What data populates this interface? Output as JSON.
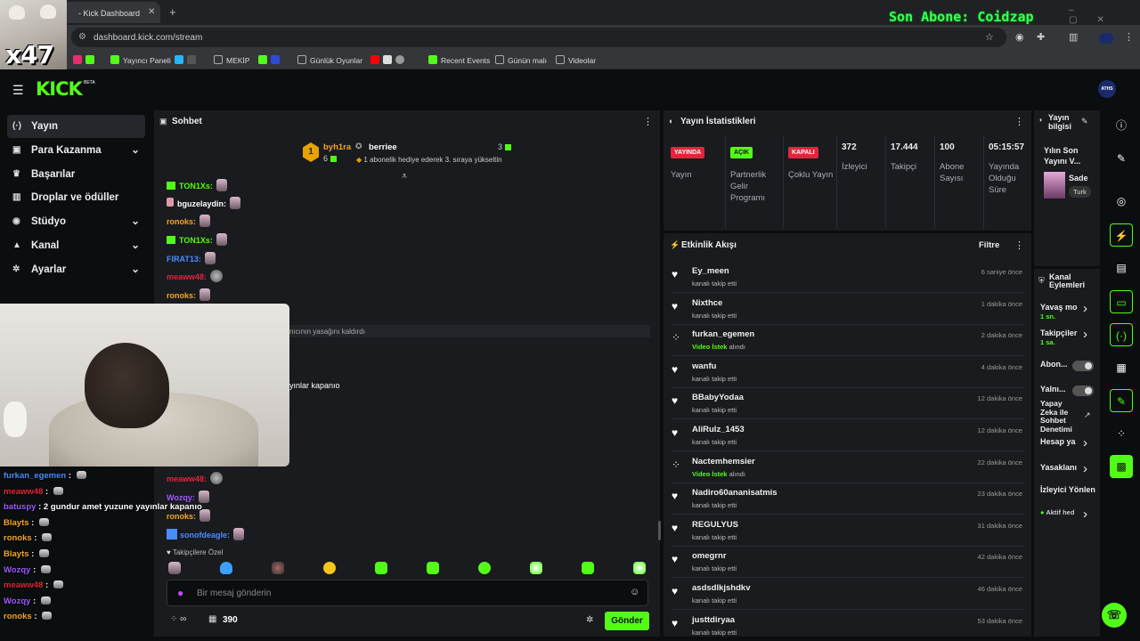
{
  "browser": {
    "tab_title": "- Kick Dashboard",
    "url": "dashboard.kick.com/stream",
    "overlay_text": "Son Abone: Coidzap",
    "cam_text": "x47",
    "bookmarks": [
      {
        "label": "Yayıncı Paneli",
        "color": "#53fc18"
      },
      {
        "label": "MEKİP",
        "color": "#888888"
      },
      {
        "label": "Günlük Oyunlar",
        "color": "#888888"
      },
      {
        "label": "Recent Events",
        "color": "#53fc18"
      },
      {
        "label": "Günün malı",
        "color": "#888888"
      },
      {
        "label": "Videolar",
        "color": "#888888"
      }
    ]
  },
  "kick": {
    "logo": "KICK",
    "logo_badge": "BETA",
    "avatar_text": "ATHS"
  },
  "nav": [
    {
      "label": "Yayın",
      "icon": "broadcast-icon",
      "glyph": "(·)",
      "active": true,
      "chevron": false
    },
    {
      "label": "Para Kazanma",
      "icon": "wallet-icon",
      "glyph": "▣",
      "active": false,
      "chevron": true
    },
    {
      "label": "Başarılar",
      "icon": "trophy-icon",
      "glyph": "♛",
      "active": false,
      "chevron": false
    },
    {
      "label": "Droplar ve ödüller",
      "icon": "gift-icon",
      "glyph": "▥",
      "active": false,
      "chevron": false
    },
    {
      "label": "Stüdyo",
      "icon": "studio-icon",
      "glyph": "◉",
      "active": false,
      "chevron": true
    },
    {
      "label": "Kanal",
      "icon": "channel-icon",
      "glyph": "▲",
      "active": false,
      "chevron": true
    },
    {
      "label": "Ayarlar",
      "icon": "gear-icon",
      "glyph": "✲",
      "active": false,
      "chevron": true
    }
  ],
  "chat": {
    "title": "Sohbet",
    "pinned": {
      "rank": "1",
      "user1": "byh1ra",
      "user1_count": "6",
      "user2": "berriee",
      "user2_count": "3",
      "message": "1 abonelik hediye ederek 3. sıraya yükseltin"
    },
    "messages": [
      {
        "user": "TON1Xs:",
        "color": "#53fc18",
        "badge": true,
        "emote": "em"
      },
      {
        "user": "bguzelaydin:",
        "color": "#ffffff",
        "badge": false,
        "emote": "em"
      },
      {
        "user": "ronoks:",
        "color": "#f5a623",
        "badge": false,
        "emote": "em"
      },
      {
        "user": "TON1Xs:",
        "color": "#53fc18",
        "badge": true,
        "emote": "em"
      },
      {
        "user": "FIRAT13:",
        "color": "#4a8dff",
        "badge": false,
        "emote": "em"
      },
      {
        "user": "meaww48:",
        "color": "#e5243b",
        "badge": false,
        "emote": "em2"
      },
      {
        "user": "ronoks:",
        "color": "#f5a623",
        "badge": false,
        "emote": "em"
      }
    ],
    "mod_message": "nıcının yasağını kaldırdı",
    "partial_line": "yınlar kapanıo",
    "lower_messages": [
      {
        "user": "meaww48:",
        "color": "#e5243b",
        "emote": "em2"
      },
      {
        "user": "Wozqy:",
        "color": "#9b59ff",
        "emote": "em"
      },
      {
        "user": "ronoks:",
        "color": "#f5a623",
        "emote": "em"
      },
      {
        "user": "sonofdeagle:",
        "color": "#4a8dff",
        "emote": "em"
      }
    ],
    "followers_only": "Takipçilere Özel",
    "input_placeholder": "Bir mesaj gönderin",
    "points": "390",
    "send_label": "Gönder"
  },
  "overlay_chat": [
    {
      "user": "furkan_egemen",
      "color": "#4a8dff",
      "msg": ""
    },
    {
      "user": "meaww48",
      "color": "#e5243b",
      "msg": ""
    },
    {
      "user": "batuspy",
      "color": "#9b59ff",
      "msg": "2 gundur amet yuzune yayınlar kapanıo"
    },
    {
      "user": "Blayts",
      "color": "#f5a623",
      "msg": ""
    },
    {
      "user": "ronoks",
      "color": "#f5a623",
      "msg": ""
    },
    {
      "user": "Blayts",
      "color": "#f5a623",
      "msg": ""
    },
    {
      "user": "Wozqy",
      "color": "#9b59ff",
      "msg": ""
    },
    {
      "user": "meaww48",
      "color": "#e5243b",
      "msg": ""
    },
    {
      "user": "Wozqy",
      "color": "#9b59ff",
      "msg": ""
    },
    {
      "user": "ronoks",
      "color": "#f5a623",
      "msg": ""
    }
  ],
  "stats": {
    "title": "Yayın İstatistikleri",
    "cols": [
      {
        "pill": "YAYINDA",
        "pill_color": "#e5243b",
        "label": "Yayın"
      },
      {
        "pill": "AÇIK",
        "pill_color": "#53fc18",
        "label": "Partnerlik Gelir Programı"
      },
      {
        "pill": "KAPALI",
        "pill_color": "#e5243b",
        "label": "Çoklu Yayın"
      },
      {
        "num": "372",
        "label": "İzleyici"
      },
      {
        "num": "17.444",
        "label": "Takipçi"
      },
      {
        "num": "100",
        "label": "Abone Sayısı"
      },
      {
        "num": "05:15:57",
        "label": "Yayında Olduğu Süre"
      }
    ]
  },
  "activity": {
    "title": "Etkinlik Akışı",
    "filter": "Filtre",
    "items": [
      {
        "name": "Ey_meen",
        "sub": "kanalı takip etti",
        "time": "6 saniye önce",
        "type": "follow"
      },
      {
        "name": "Nixthce",
        "sub": "kanalı takip etti",
        "time": "1 dakika önce",
        "type": "follow"
      },
      {
        "name": "furkan_egemen",
        "sub_green": "Video İstek",
        "sub": "alındı",
        "time": "2 dakika önce",
        "type": "reward"
      },
      {
        "name": "wanfu",
        "sub": "kanalı takip etti",
        "time": "4 dakika önce",
        "type": "follow"
      },
      {
        "name": "BBabyYodaa",
        "sub": "kanalı takip etti",
        "time": "12 dakika önce",
        "type": "follow"
      },
      {
        "name": "AliRulz_1453",
        "sub": "kanalı takip etti",
        "time": "12 dakika önce",
        "type": "follow"
      },
      {
        "name": "Nactemhemsier",
        "sub_green": "Video İstek",
        "sub": "alındı",
        "time": "22 dakika önce",
        "type": "reward"
      },
      {
        "name": "Nadiro60ananisatmis",
        "sub": "kanalı takip etti",
        "time": "23 dakika önce",
        "type": "follow"
      },
      {
        "name": "REGULYUS",
        "sub": "kanalı takip etti",
        "time": "31 dakika önce",
        "type": "follow"
      },
      {
        "name": "omegrnr",
        "sub": "kanalı takip etti",
        "time": "42 dakika önce",
        "type": "follow"
      },
      {
        "name": "asdsdlkjshdkv",
        "sub": "kanalı takip etti",
        "time": "46 dakika önce",
        "type": "follow"
      },
      {
        "name": "justtdiryaa",
        "sub": "kanalı takip etti",
        "time": "53 dakika önce",
        "type": "follow"
      }
    ]
  },
  "info": {
    "title_1": "Yayın",
    "title_2": "bilgisi",
    "stream_title": "Yılın Son Yayını V...",
    "category": "Sade",
    "tag": "Turk"
  },
  "actions": {
    "title_1": "Kanal",
    "title_2": "Eylemleri",
    "items": [
      {
        "label": "Yavaş mo",
        "sub": "1 sn.",
        "kind": "chevron"
      },
      {
        "label": "Takipçiler",
        "sub": "1 sa.",
        "kind": "chevron"
      },
      {
        "label": "Abon...",
        "kind": "toggle"
      },
      {
        "label": "Yalnı...",
        "kind": "toggle"
      },
      {
        "label": "Yapay Zeka ile Sohbet Denetimi",
        "kind": "link"
      },
      {
        "label": "Hesap ya",
        "kind": "chevron"
      },
      {
        "label": "Yasaklanı",
        "kind": "chevron"
      },
      {
        "label": "İzleyici Yönlen",
        "kind": "none"
      },
      {
        "label": "Aktif hed",
        "kind": "chevron"
      }
    ]
  },
  "accent": "#53fc18"
}
